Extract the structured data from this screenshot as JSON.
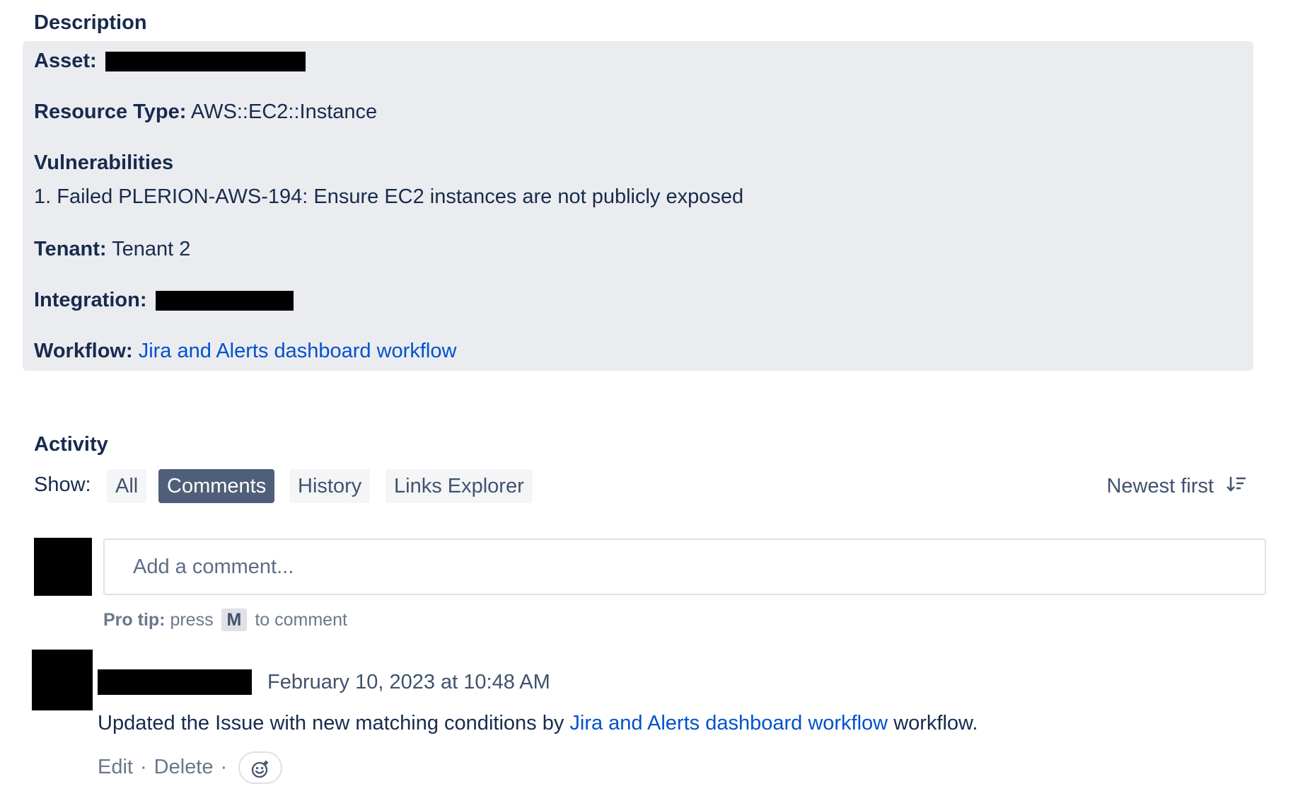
{
  "description": {
    "title": "Description",
    "asset_label": "Asset:",
    "resource_type_label": "Resource Type:",
    "resource_type_value": "AWS::EC2::Instance",
    "vulnerabilities_label": "Vulnerabilities",
    "vulnerability_item": "1. Failed PLERION-AWS-194: Ensure EC2 instances are not publicly exposed",
    "tenant_label": "Tenant:",
    "tenant_value": "Tenant 2",
    "integration_label": "Integration:",
    "workflow_label": "Workflow:",
    "workflow_link": "Jira and Alerts dashboard workflow"
  },
  "activity": {
    "title": "Activity",
    "show_label": "Show:",
    "filters": [
      {
        "label": "All",
        "active": false
      },
      {
        "label": "Comments",
        "active": true
      },
      {
        "label": "History",
        "active": false
      },
      {
        "label": "Links Explorer",
        "active": false
      }
    ],
    "sort_label": "Newest first",
    "sort_icon": "sort-descending-icon"
  },
  "comment_box": {
    "placeholder": "Add a comment...",
    "pro_tip_label": "Pro tip:",
    "pro_tip_press": "press",
    "pro_tip_key": "M",
    "pro_tip_suffix": "to comment"
  },
  "comment": {
    "timestamp": "February 10, 2023 at 10:48 AM",
    "body_prefix": "Updated the Issue with new matching conditions by",
    "body_link": "Jira and Alerts dashboard workflow",
    "body_suffix": "workflow.",
    "edit_label": "Edit",
    "separator": "·",
    "delete_label": "Delete",
    "reaction_icon": "add-reaction-icon"
  },
  "colors": {
    "panel_bg": "#ebecf0",
    "link": "#0052cc",
    "active_filter_bg": "#505f79",
    "text": "#172b4d"
  }
}
